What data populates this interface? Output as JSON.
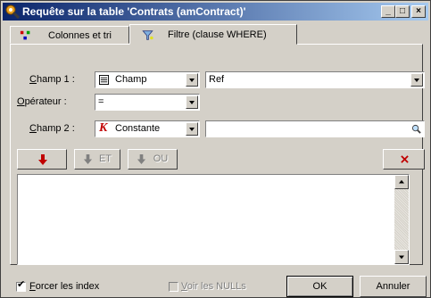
{
  "window": {
    "title": "Requête sur la table 'Contrats (amContract)'",
    "controls": {
      "minimize": "_",
      "maximize": "□",
      "close": "×"
    }
  },
  "tabs": [
    {
      "label": "Colonnes et tri"
    },
    {
      "label": "Filtre (clause WHERE)"
    }
  ],
  "form": {
    "champ1_label": "hamp 1 :",
    "champ1_accel": "C",
    "champ1_type": "Champ",
    "champ1_value": "Ref",
    "operateur_label": "pérateur :",
    "operateur_accel": "O",
    "operateur_value": "=",
    "champ2_label": "hamp 2 :",
    "champ2_accel": "C",
    "champ2_type": "Constante",
    "champ2_value": ""
  },
  "toolbar": {
    "et_label": "ET",
    "ou_label": "OU"
  },
  "bottom": {
    "force_index_label": "orcer les index",
    "force_index_accel": "F",
    "force_index_checked": true,
    "voir_nulls_label": "oir les NULLs",
    "voir_nulls_accel": "V",
    "voir_nulls_checked": false,
    "ok_label": "OK",
    "cancel_label": "Annuler"
  },
  "icons": {
    "app": "query-icon",
    "tab1": "columns-icon",
    "tab2": "filter-icon",
    "champ1": "field-icon",
    "champ2": "constant-icon",
    "champ2_value": "magnifier-icon",
    "add": "arrow-down-icon",
    "and": "arrow-down-icon",
    "or": "arrow-down-icon",
    "delete": "delete-icon"
  },
  "colors": {
    "accent_red": "#c00000"
  }
}
